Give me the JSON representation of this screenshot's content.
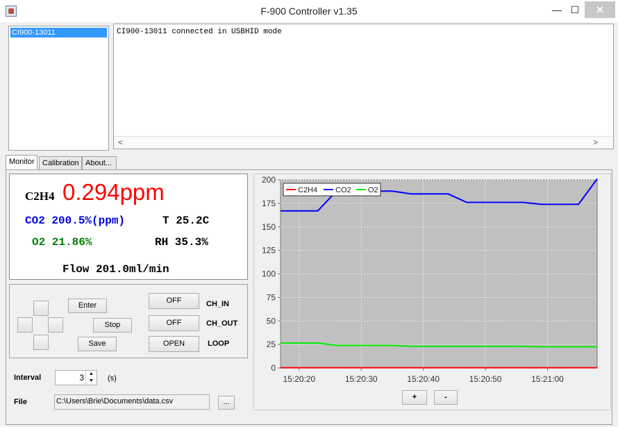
{
  "window": {
    "title": "F-900 Controller v1.35",
    "minimize": "—",
    "maximize": "☐",
    "close": "✕"
  },
  "devices": [
    "CI900-13011"
  ],
  "log": {
    "text": "CI900-13011 connected in USBHID mode",
    "scroll_left": "<",
    "scroll_right": ">"
  },
  "tabs": [
    "Monitor",
    "Calibration",
    "About..."
  ],
  "readings": {
    "c2h4_label": "C2H4",
    "c2h4_value": "0.294ppm",
    "co2": "CO2 200.5%(ppm)",
    "temp": "T 25.2C",
    "o2": "O2 21.86%",
    "rh": "RH 35.3%",
    "flow": "Flow 201.0ml/min",
    "colors": {
      "c2h4": "#ff0000",
      "co2": "#0000dd",
      "o2": "#008000"
    }
  },
  "controls": {
    "enter": "Enter",
    "stop": "Stop",
    "save": "Save",
    "ch_in_btn": "OFF",
    "ch_in_label": "CH_IN",
    "ch_out_btn": "OFF",
    "ch_out_label": "CH_OUT",
    "loop_btn": "OPEN",
    "loop_label": "LOOP"
  },
  "interval": {
    "label": "Interval",
    "value": "3",
    "unit": "(s)"
  },
  "file": {
    "label": "File",
    "path": "C:\\Users\\Brie\\Documents\\data.csv",
    "browse": "..."
  },
  "zoom": {
    "plus": "+",
    "minus": "-"
  },
  "chart_data": {
    "type": "line",
    "x": [
      "15:20:17",
      "15:20:20",
      "15:20:23",
      "15:20:26",
      "15:20:29",
      "15:20:32",
      "15:20:35",
      "15:20:38",
      "15:20:41",
      "15:20:44",
      "15:20:47",
      "15:20:50",
      "15:20:53",
      "15:20:56",
      "15:20:59",
      "15:21:02",
      "15:21:05",
      "15:21:08"
    ],
    "xticks": [
      "15:20:20",
      "15:20:30",
      "15:20:40",
      "15:20:50",
      "15:21:00"
    ],
    "ylim": [
      0,
      200
    ],
    "yticks": [
      0,
      25,
      50,
      75,
      100,
      125,
      150,
      175,
      200
    ],
    "grid": true,
    "legend": "top-left",
    "series": [
      {
        "name": "C2H4",
        "color": "#ff0000",
        "values": [
          0.3,
          0.3,
          0.3,
          0.3,
          0.3,
          0.3,
          0.3,
          0.3,
          0.3,
          0.3,
          0.3,
          0.3,
          0.3,
          0.3,
          0.3,
          0.3,
          0.3,
          0.3
        ]
      },
      {
        "name": "CO2",
        "color": "#0000ff",
        "values": [
          167,
          167,
          167,
          188,
          188,
          188,
          188,
          185,
          185,
          185,
          176,
          176,
          176,
          176,
          174,
          174,
          174,
          201
        ]
      },
      {
        "name": "O2",
        "color": "#00ee00",
        "values": [
          26.5,
          26.5,
          26.5,
          24,
          24,
          24,
          24,
          23,
          23,
          23,
          23,
          23,
          23,
          23,
          22.5,
          22.5,
          22.5,
          22.5
        ]
      }
    ]
  }
}
